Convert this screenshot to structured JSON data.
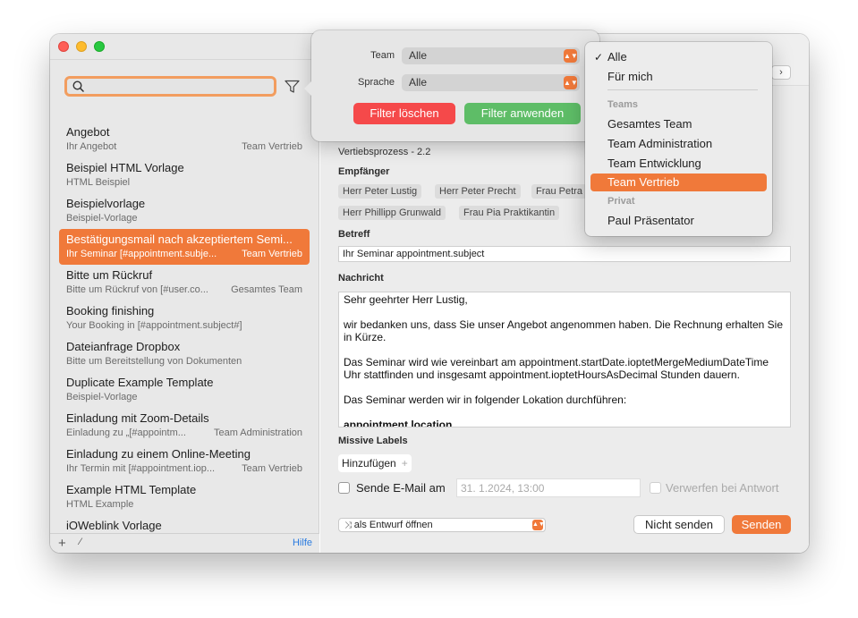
{
  "search": {
    "placeholder": ""
  },
  "templates": [
    {
      "title": "Angebot",
      "subtitle": "Ihr Angebot",
      "team": "Team Vertrieb"
    },
    {
      "title": "Beispiel HTML Vorlage",
      "subtitle": "HTML Beispiel",
      "team": ""
    },
    {
      "title": "Beispielvorlage",
      "subtitle": "Beispiel-Vorlage",
      "team": ""
    },
    {
      "title": "Bestätigungsmail nach akzeptiertem Semi...",
      "subtitle": "Ihr Seminar [#appointment.subje...",
      "team": "Team Vertrieb"
    },
    {
      "title": "Bitte um Rückruf",
      "subtitle": "Bitte um Rückruf von [#user.co...",
      "team": "Gesamtes Team"
    },
    {
      "title": "Booking finishing",
      "subtitle": "Your Booking in [#appointment.subject#]",
      "team": ""
    },
    {
      "title": "Dateianfrage Dropbox",
      "subtitle": "Bitte um Bereitstellung von Dokumenten",
      "team": ""
    },
    {
      "title": "Duplicate Example Template",
      "subtitle": "Beispiel-Vorlage",
      "team": ""
    },
    {
      "title": "Einladung mit Zoom-Details",
      "subtitle": "Einladung zu „[#appointm...",
      "team": "Team Administration"
    },
    {
      "title": "Einladung zu einem Online-Meeting",
      "subtitle": "Ihr Termin mit [#appointment.iop...",
      "team": "Team Vertrieb"
    },
    {
      "title": "Example HTML Template",
      "subtitle": "HTML Example",
      "team": ""
    },
    {
      "title": "iOWeblink Vorlage",
      "subtitle": "",
      "team": ""
    }
  ],
  "sidebar_footer": {
    "add": "+",
    "edit": "⁄",
    "help": "Hilfe"
  },
  "filter_popover": {
    "team_label": "Team",
    "team_value": "Alle",
    "language_label": "Sprache",
    "language_value": "Alle",
    "clear_label": "Filter löschen",
    "apply_label": "Filter anwenden"
  },
  "team_menu": {
    "alle": "Alle",
    "fuer_mich": "Für mich",
    "teams_header": "Teams",
    "gesamtes_team": "Gesamtes Team",
    "administration": "Team Administration",
    "entwicklung": "Team Entwicklung",
    "vertrieb": "Team Vertrieb",
    "privat_header": "Privat",
    "paul": "Paul Präsentator"
  },
  "compose": {
    "process": "Vertiebsprozess - 2.2",
    "recipients_label": "Empfänger",
    "recipients": [
      "Herr Peter Lustig",
      "Herr Peter Precht",
      "Frau Petra",
      "Herr Phillipp Grunwald",
      "Frau Pia Praktikantin"
    ],
    "subject_label": "Betreff",
    "subject_value": "Ihr Seminar appointment.subject",
    "message_label": "Nachricht",
    "message_lines": [
      "Sehr geehrter Herr Lustig,",
      "wir bedanken uns, dass Sie unser Angebot angenommen haben. Die Rechnung erhalten Sie in Kürze.",
      "Das Seminar wird wie vereinbart am appointment.startDate.ioptetMergeMediumDateTime Uhr stattfinden und insgesamt appointment.ioptetHoursAsDecimal Stunden dauern.",
      "Das Seminar werden wir in folgender Lokation durchführen:",
      "appointment.location"
    ],
    "labels_label": "Missive Labels",
    "add_label": "Hinzufügen",
    "send_email_label": "Sende E-Mail am",
    "send_date": "31.  1.2024, 13:00",
    "discard_label": "Verwerfen bei Antwort",
    "open_as": "als Entwurf öffnen",
    "dont_send": "Nicht senden",
    "send": "Senden"
  },
  "colors": {
    "accent": "#f0793a",
    "clear": "#f5494a",
    "apply": "#5ebd67",
    "link": "#2a7be0"
  }
}
